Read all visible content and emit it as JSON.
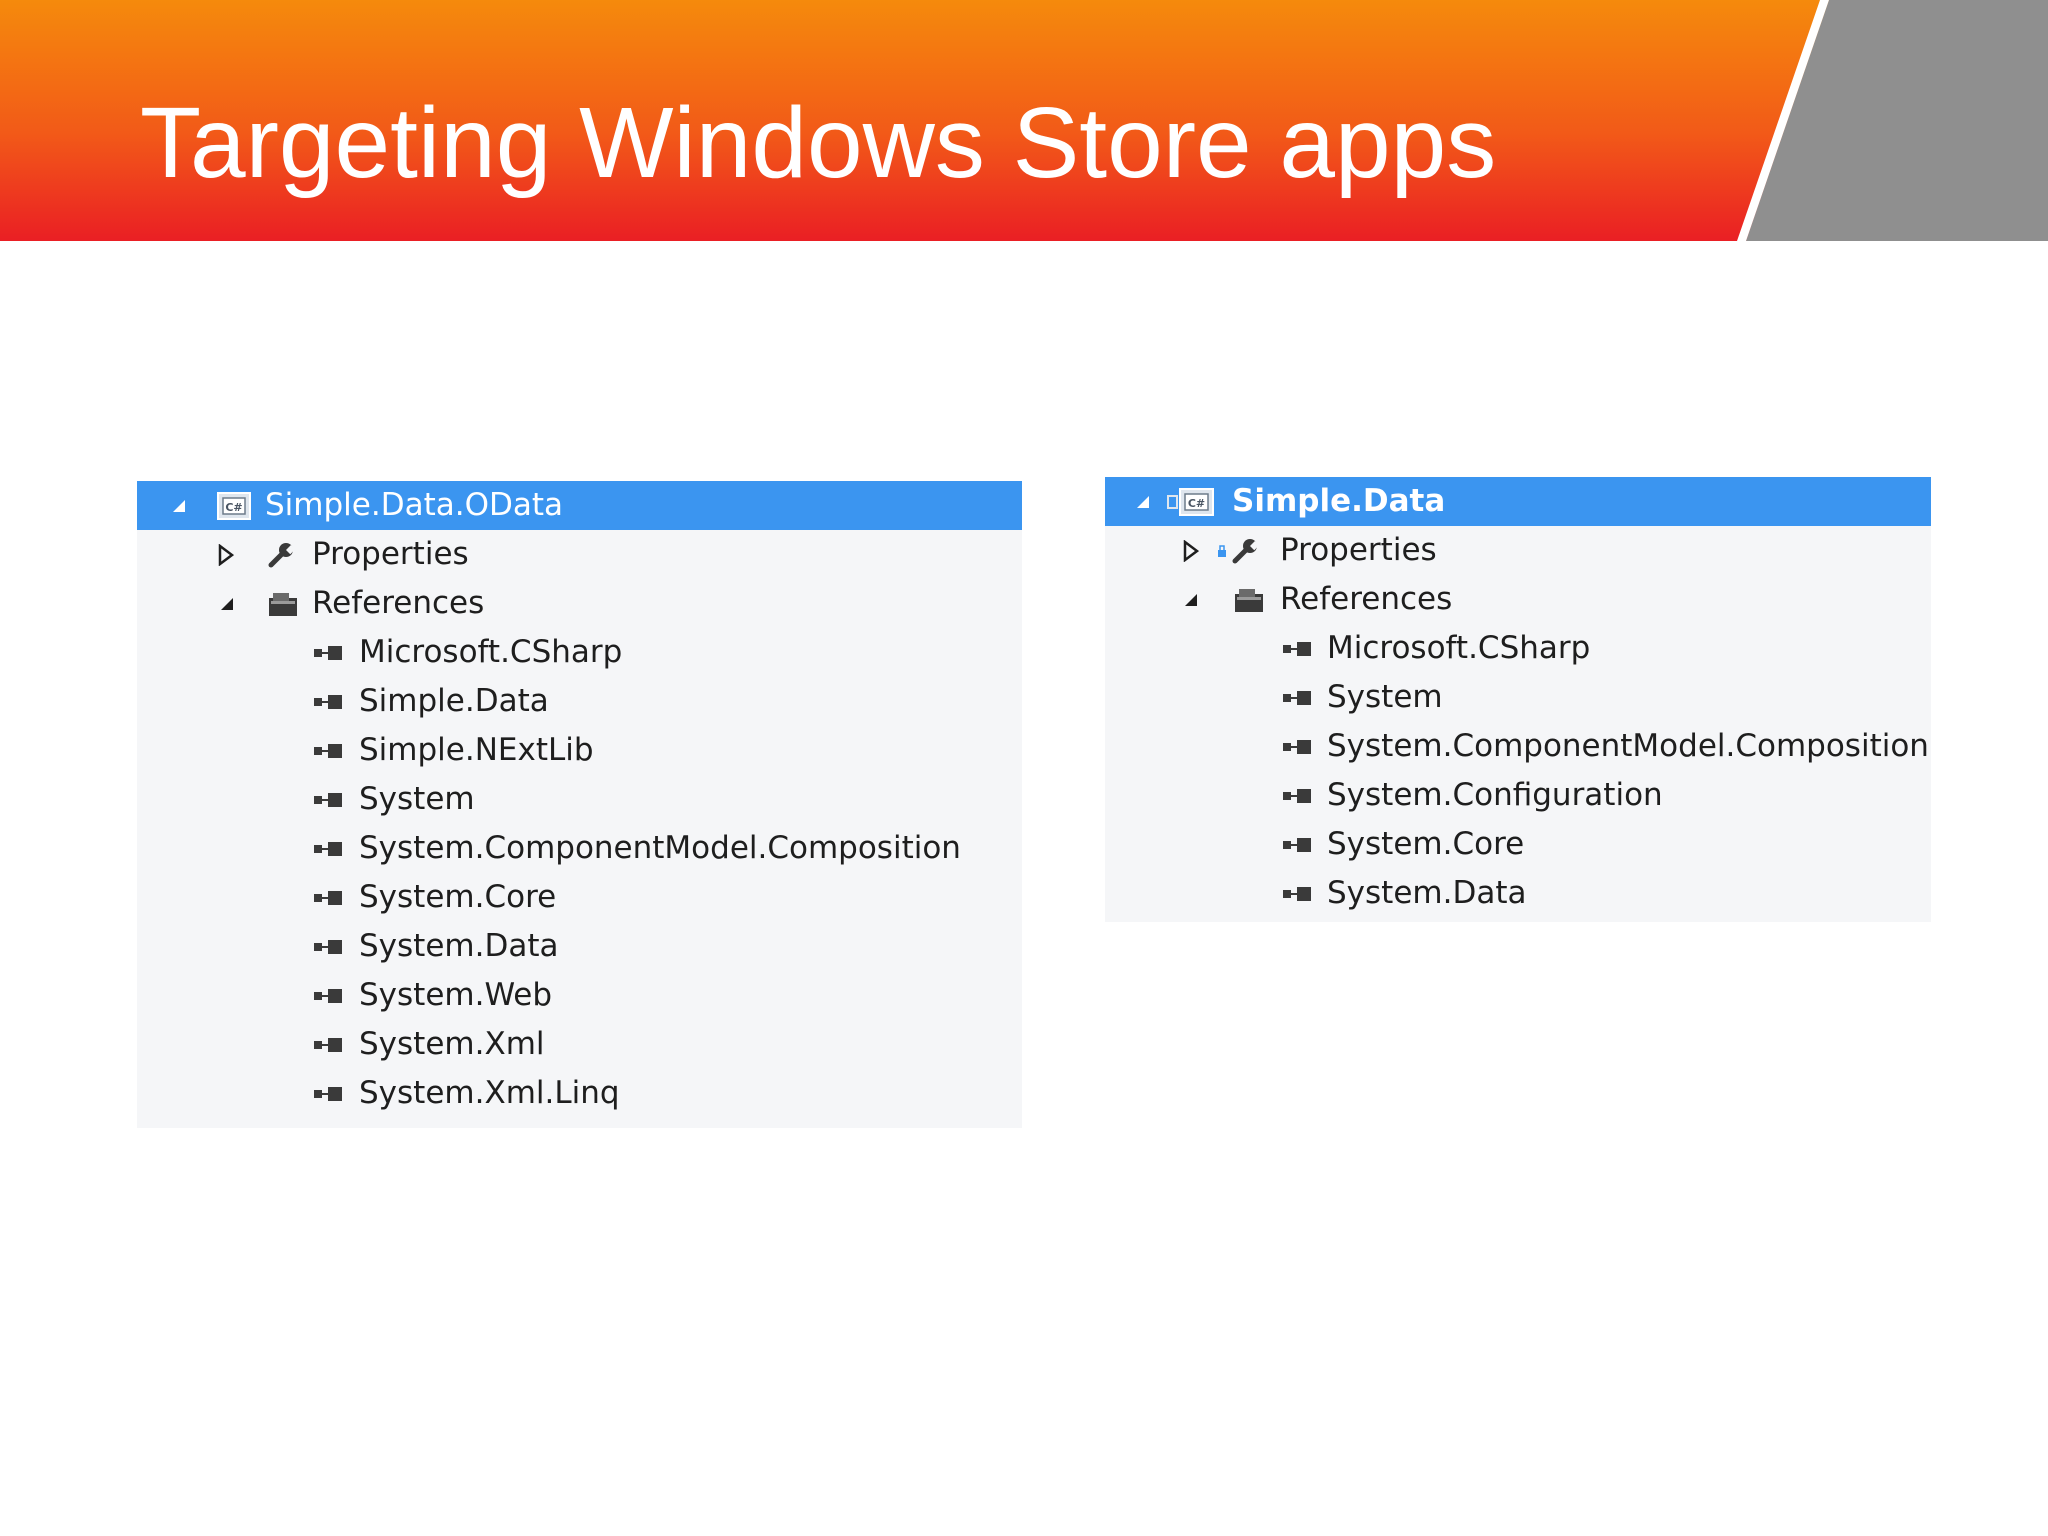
{
  "slide": {
    "title": "Targeting Windows Store apps"
  },
  "colors": {
    "banner_top": "#f58a0c",
    "banner_bottom": "#ea1f24",
    "banner_grey": "#8f8f8f",
    "selection": "#3b95f0",
    "tree_background": "#f5f6f8"
  },
  "left_tree": {
    "project": {
      "label": "Simple.Data.OData",
      "expanded": true,
      "icon": "csharp-project-icon"
    },
    "properties": {
      "label": "Properties",
      "expanded": false,
      "icon": "wrench-icon"
    },
    "references": {
      "label": "References",
      "expanded": true,
      "icon": "folder-references-icon",
      "items": [
        "Microsoft.CSharp",
        "Simple.Data",
        "Simple.NExtLib",
        "System",
        "System.ComponentModel.Composition",
        "System.Core",
        "System.Data",
        "System.Web",
        "System.Xml",
        "System.Xml.Linq"
      ]
    }
  },
  "right_tree": {
    "project": {
      "label": "Simple.Data",
      "expanded": true,
      "icon": "csharp-project-icon"
    },
    "properties": {
      "label": "Properties",
      "expanded": false,
      "icon": "wrench-icon"
    },
    "references": {
      "label": "References",
      "expanded": true,
      "icon": "folder-references-icon",
      "items": [
        "Microsoft.CSharp",
        "System",
        "System.ComponentModel.Composition",
        "System.Configuration",
        "System.Core",
        "System.Data"
      ]
    }
  }
}
